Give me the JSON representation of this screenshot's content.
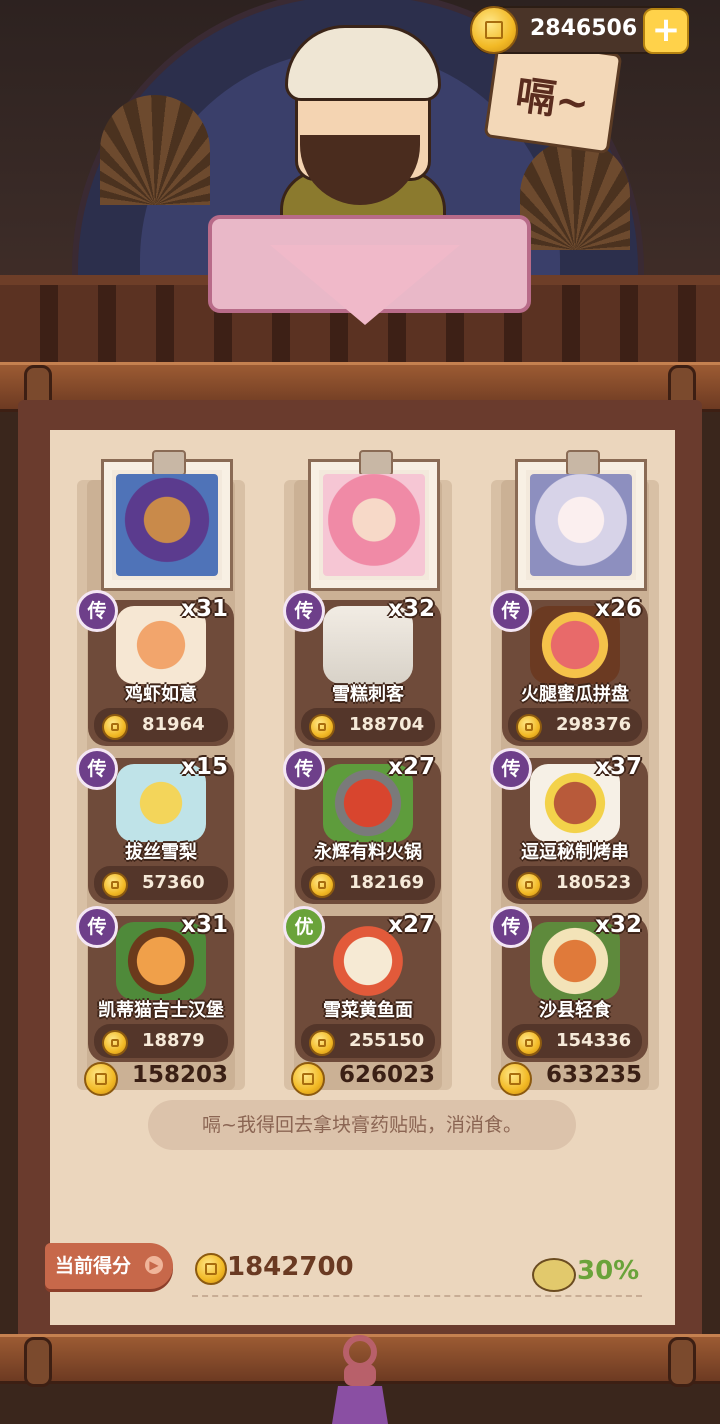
{
  "top_bar": {
    "coin_count": "2846506",
    "add_label": "+"
  },
  "sign_text": "嗝~",
  "columns": [
    {
      "total": "158203",
      "dishes": [
        {
          "badge": "传",
          "qty": "x31",
          "name": "鸡虾如意",
          "price": "81964"
        },
        {
          "badge": "传",
          "qty": "x15",
          "name": "拔丝雪梨",
          "price": "57360"
        },
        {
          "badge": "传",
          "qty": "x31",
          "name": "凯蒂猫吉士汉堡",
          "price": "18879"
        }
      ]
    },
    {
      "total": "626023",
      "dishes": [
        {
          "badge": "传",
          "qty": "x32",
          "name": "雪糕刺客",
          "price": "188704"
        },
        {
          "badge": "传",
          "qty": "x27",
          "name": "永辉有料火锅",
          "price": "182169"
        },
        {
          "badge": "优",
          "qty": "x27",
          "name": "雪菜黄鱼面",
          "price": "255150"
        }
      ]
    },
    {
      "total": "633235",
      "dishes": [
        {
          "badge": "传",
          "qty": "x26",
          "name": "火腿蜜瓜拼盘",
          "price": "298376"
        },
        {
          "badge": "传",
          "qty": "x37",
          "name": "逗逗秘制烤串",
          "price": "180523"
        },
        {
          "badge": "传",
          "qty": "x32",
          "name": "沙县轻食",
          "price": "154336"
        }
      ]
    }
  ],
  "quote": "嗝~我得回去拿块膏药贴贴，消消食。",
  "score": {
    "label": "当前得分",
    "value": "1842700",
    "bonus": "30%"
  }
}
